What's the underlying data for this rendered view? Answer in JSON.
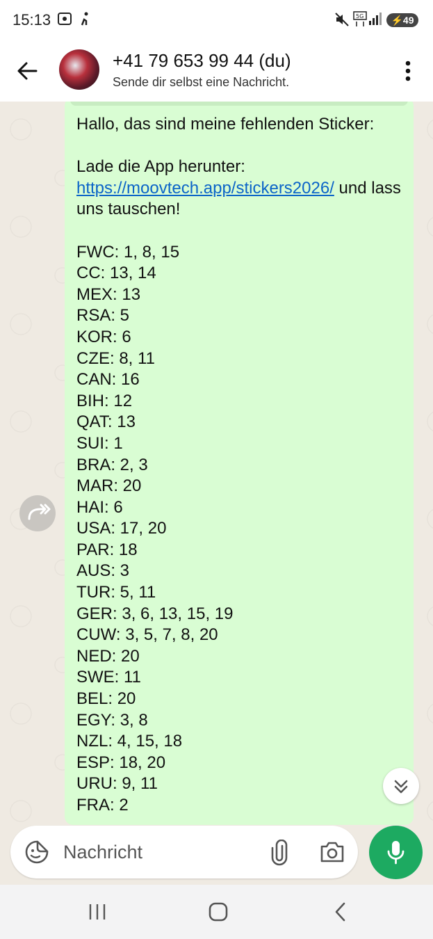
{
  "status_bar": {
    "time": "15:13",
    "battery": "49"
  },
  "header": {
    "contact_name": "+41 79 653 99 44 (du)",
    "subtitle": "Sende dir selbst eine Nachricht."
  },
  "message": {
    "greeting": "Hallo, das sind meine fehlenden Sticker:",
    "download_prefix": "Lade die App herunter: ",
    "link_text": "https://moovtech.app/stickers2026/",
    "download_suffix": " und lass uns tauschen!",
    "stickers": [
      "FWC: 1, 8, 15",
      "CC: 13, 14",
      "MEX: 13",
      "RSA: 5",
      "KOR: 6",
      "CZE: 8, 11",
      "CAN: 16",
      "BIH: 12",
      "QAT: 13",
      "SUI: 1",
      "BRA: 2, 3",
      "MAR: 20",
      "HAI: 6",
      "USA: 17, 20",
      "PAR: 18",
      "AUS: 3",
      "TUR: 5, 11",
      "GER: 3, 6, 13, 15, 19",
      "CUW: 3, 5, 7, 8, 20",
      "NED: 20",
      "SWE: 11",
      "BEL: 20",
      "EGY: 3, 8",
      "NZL: 4, 15, 18",
      "ESP: 18, 20",
      "URU: 9, 11",
      "FRA: 2"
    ]
  },
  "composer": {
    "placeholder": "Nachricht"
  },
  "icons": {
    "back": "arrow-left-icon",
    "menu": "more-vertical-icon",
    "forward": "forward-icon",
    "scroll_down": "chevrons-down-icon",
    "emoji": "sticker-smiley-icon",
    "attach": "paperclip-icon",
    "camera": "camera-icon",
    "mic": "microphone-icon",
    "nav_recents": "recents-icon",
    "nav_home": "home-icon",
    "nav_back": "nav-back-icon"
  },
  "colors": {
    "bubble": "#d9fdd3",
    "chat_bg": "#efeae2",
    "link": "#0b64c8",
    "mic_button": "#1daa61"
  }
}
